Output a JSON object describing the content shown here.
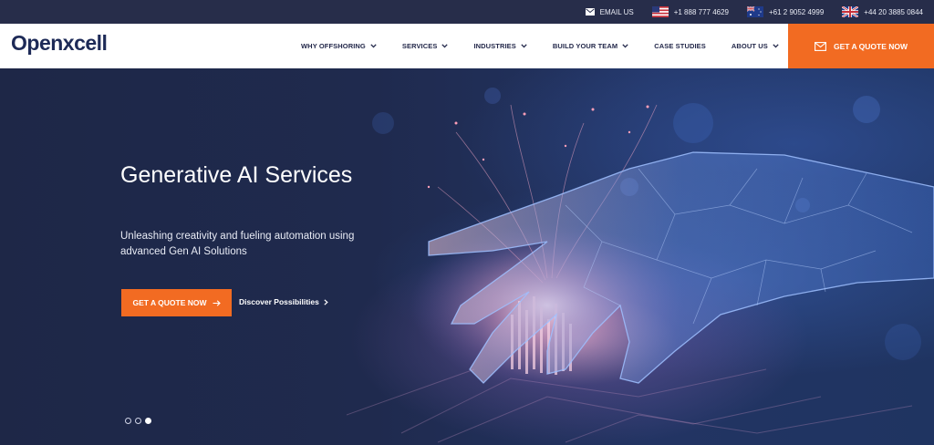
{
  "topbar": {
    "email_label": "EMAIL US",
    "phones": [
      {
        "flag": "us-flag-icon",
        "number": "+1 888 777 4629"
      },
      {
        "flag": "au-flag-icon",
        "number": "+61 2 9052 4999"
      },
      {
        "flag": "uk-flag-icon",
        "number": "+44 20 3885 0844"
      }
    ]
  },
  "header": {
    "logo": "Openxcell",
    "nav": [
      {
        "label": "WHY OFFSHORING",
        "has_dropdown": true
      },
      {
        "label": "SERVICES",
        "has_dropdown": true
      },
      {
        "label": "INDUSTRIES",
        "has_dropdown": true
      },
      {
        "label": "BUILD YOUR TEAM",
        "has_dropdown": true
      },
      {
        "label": "CASE STUDIES",
        "has_dropdown": false
      },
      {
        "label": "ABOUT US",
        "has_dropdown": true
      }
    ],
    "search_icon": "search-icon",
    "quote_button": "GET A QUOTE NOW"
  },
  "hero": {
    "title": "Generative AI Services",
    "subtitle": "Unleashing creativity and fueling automation using advanced Gen AI Solutions",
    "cta_label": "GET A QUOTE NOW",
    "link_label": "Discover Possibilities",
    "slides": 3,
    "active_slide": 3
  },
  "colors": {
    "brand_navy": "#1d2a57",
    "accent_orange": "#f26b22",
    "topbar_bg": "#272d4a",
    "hero_bg": "#1f2a4e"
  }
}
